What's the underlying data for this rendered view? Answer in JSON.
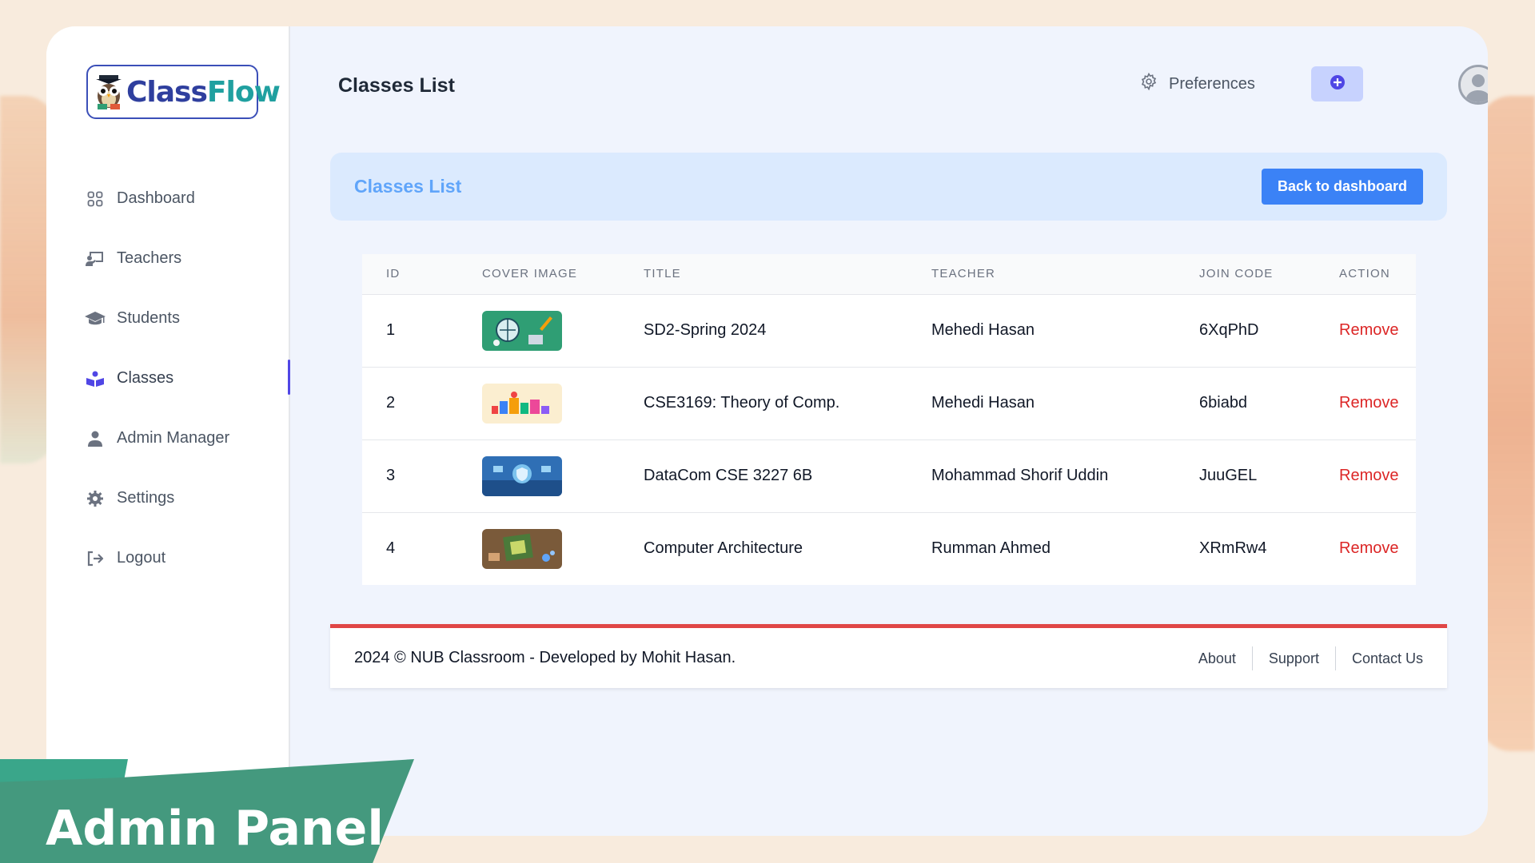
{
  "app": {
    "logo_text_a": "Class",
    "logo_text_b": "Flow"
  },
  "sidebar": {
    "items": [
      {
        "label": "Dashboard",
        "icon": "grid-icon"
      },
      {
        "label": "Teachers",
        "icon": "teacher-board-icon"
      },
      {
        "label": "Students",
        "icon": "graduation-cap-icon"
      },
      {
        "label": "Classes",
        "icon": "book-reader-icon",
        "active": true
      },
      {
        "label": "Admin Manager",
        "icon": "user-icon"
      },
      {
        "label": "Settings",
        "icon": "gear-icon"
      },
      {
        "label": "Logout",
        "icon": "logout-icon"
      }
    ]
  },
  "header": {
    "page_title": "Classes List",
    "preferences_label": "Preferences"
  },
  "card": {
    "title": "Classes List",
    "back_button": "Back to dashboard"
  },
  "table": {
    "columns": [
      "ID",
      "COVER IMAGE",
      "TITLE",
      "TEACHER",
      "JOIN CODE",
      "ACTION"
    ],
    "rows": [
      {
        "id": "1",
        "title": "SD2-Spring 2024",
        "teacher": "Mehedi Hasan",
        "code": "6XqPhD",
        "action": "Remove"
      },
      {
        "id": "2",
        "title": "CSE3169: Theory of Comp.",
        "teacher": "Mehedi Hasan",
        "code": "6biabd",
        "action": "Remove"
      },
      {
        "id": "3",
        "title": "DataCom CSE 3227 6B",
        "teacher": "Mohammad Shorif Uddin",
        "code": "JuuGEL",
        "action": "Remove"
      },
      {
        "id": "4",
        "title": "Computer Architecture",
        "teacher": "Rumman Ahmed",
        "code": "XRmRw4",
        "action": "Remove"
      }
    ]
  },
  "footer": {
    "copyright": "2024 © NUB Classroom - Developed by Mohit Hasan.",
    "links": [
      "About",
      "Support",
      "Contact Us"
    ]
  },
  "banner": {
    "text": "Admin Panel"
  },
  "colors": {
    "accent": "#3b82f6",
    "active_indicator": "#5046e5",
    "danger": "#dc2626",
    "banner": "#44997e"
  }
}
